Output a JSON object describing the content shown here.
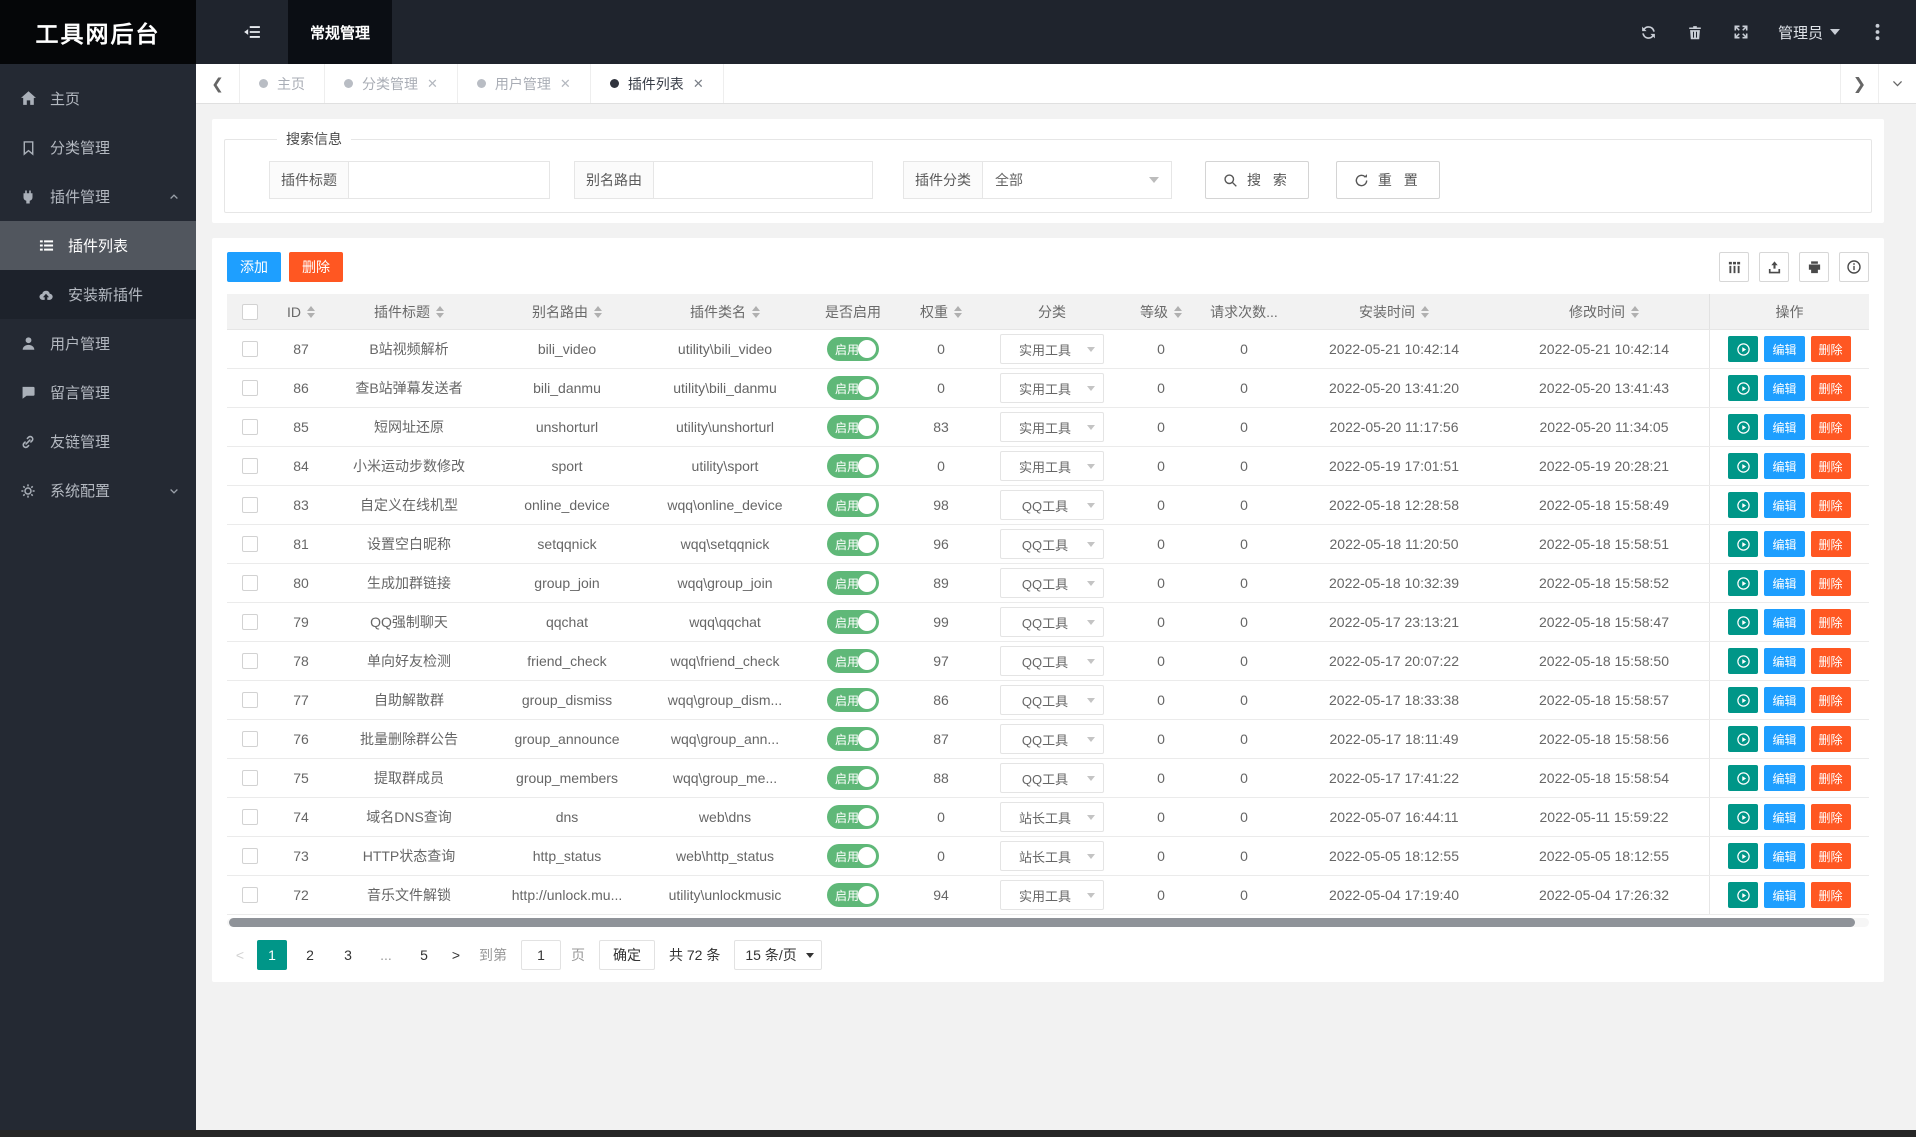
{
  "app": {
    "title": "工具网后台"
  },
  "topbar": {
    "nav_active": "常规管理",
    "user": "管理员",
    "icons": [
      "fold-icon",
      "refresh-icon",
      "trash-icon",
      "fullscreen-icon",
      "more-vertical-icon"
    ]
  },
  "sidebar": {
    "items": [
      {
        "label": "主页",
        "icon": "home-icon"
      },
      {
        "label": "分类管理",
        "icon": "bookmark-icon"
      },
      {
        "label": "插件管理",
        "icon": "plugin-icon",
        "expanded": true,
        "children": [
          {
            "label": "插件列表",
            "icon": "list-icon",
            "active": true
          },
          {
            "label": "安装新插件",
            "icon": "cloud-upload-icon"
          }
        ]
      },
      {
        "label": "用户管理",
        "icon": "user-icon"
      },
      {
        "label": "留言管理",
        "icon": "comment-icon"
      },
      {
        "label": "友链管理",
        "icon": "link-icon"
      },
      {
        "label": "系统配置",
        "icon": "gears-icon",
        "collapsed": true
      }
    ]
  },
  "tabs": [
    {
      "label": "主页",
      "closable": false,
      "active": false
    },
    {
      "label": "分类管理",
      "closable": true,
      "active": false
    },
    {
      "label": "用户管理",
      "closable": true,
      "active": false
    },
    {
      "label": "插件列表",
      "closable": true,
      "active": true
    }
  ],
  "search": {
    "legend": "搜索信息",
    "title_label": "插件标题",
    "title_value": "",
    "route_label": "别名路由",
    "route_value": "",
    "category_label": "插件分类",
    "category_value": "全部",
    "search_label": "搜 索",
    "reset_label": "重 置"
  },
  "toolbar": {
    "add_label": "添加",
    "delete_label": "删除",
    "icons": [
      "columns-filter-icon",
      "export-icon",
      "print-icon",
      "info-icon"
    ]
  },
  "table": {
    "switch_on_label": "启用",
    "actions": {
      "edit": "编辑",
      "delete": "删除"
    },
    "headers": [
      {
        "label": "ID",
        "sortable": true
      },
      {
        "label": "插件标题",
        "sortable": true
      },
      {
        "label": "别名路由",
        "sortable": true
      },
      {
        "label": "插件类名",
        "sortable": true
      },
      {
        "label": "是否启用",
        "sortable": false
      },
      {
        "label": "权重",
        "sortable": true
      },
      {
        "label": "分类",
        "sortable": false
      },
      {
        "label": "等级",
        "sortable": true
      },
      {
        "label": "请求次数...",
        "sortable": false
      },
      {
        "label": "安装时间",
        "sortable": true
      },
      {
        "label": "修改时间",
        "sortable": true
      },
      {
        "label": "操作",
        "sortable": false
      }
    ],
    "rows": [
      {
        "id": "87",
        "title": "B站视频解析",
        "route": "bili_video",
        "clazz": "utility\\bili_video",
        "weight": "0",
        "category": "实用工具",
        "level": "0",
        "requests": "0",
        "installed": "2022-05-21 10:42:14",
        "modified": "2022-05-21 10:42:14"
      },
      {
        "id": "86",
        "title": "查B站弹幕发送者",
        "route": "bili_danmu",
        "clazz": "utility\\bili_danmu",
        "weight": "0",
        "category": "实用工具",
        "level": "0",
        "requests": "0",
        "installed": "2022-05-20 13:41:20",
        "modified": "2022-05-20 13:41:43"
      },
      {
        "id": "85",
        "title": "短网址还原",
        "route": "unshorturl",
        "clazz": "utility\\unshorturl",
        "weight": "83",
        "category": "实用工具",
        "level": "0",
        "requests": "0",
        "installed": "2022-05-20 11:17:56",
        "modified": "2022-05-20 11:34:05"
      },
      {
        "id": "84",
        "title": "小米运动步数修改",
        "route": "sport",
        "clazz": "utility\\sport",
        "weight": "0",
        "category": "实用工具",
        "level": "0",
        "requests": "0",
        "installed": "2022-05-19 17:01:51",
        "modified": "2022-05-19 20:28:21"
      },
      {
        "id": "83",
        "title": "自定义在线机型",
        "route": "online_device",
        "clazz": "wqq\\online_device",
        "weight": "98",
        "category": "QQ工具",
        "level": "0",
        "requests": "0",
        "installed": "2022-05-18 12:28:58",
        "modified": "2022-05-18 15:58:49"
      },
      {
        "id": "81",
        "title": "设置空白昵称",
        "route": "setqqnick",
        "clazz": "wqq\\setqqnick",
        "weight": "96",
        "category": "QQ工具",
        "level": "0",
        "requests": "0",
        "installed": "2022-05-18 11:20:50",
        "modified": "2022-05-18 15:58:51"
      },
      {
        "id": "80",
        "title": "生成加群链接",
        "route": "group_join",
        "clazz": "wqq\\group_join",
        "weight": "89",
        "category": "QQ工具",
        "level": "0",
        "requests": "0",
        "installed": "2022-05-18 10:32:39",
        "modified": "2022-05-18 15:58:52"
      },
      {
        "id": "79",
        "title": "QQ强制聊天",
        "route": "qqchat",
        "clazz": "wqq\\qqchat",
        "weight": "99",
        "category": "QQ工具",
        "level": "0",
        "requests": "0",
        "installed": "2022-05-17 23:13:21",
        "modified": "2022-05-18 15:58:47"
      },
      {
        "id": "78",
        "title": "单向好友检测",
        "route": "friend_check",
        "clazz": "wqq\\friend_check",
        "weight": "97",
        "category": "QQ工具",
        "level": "0",
        "requests": "0",
        "installed": "2022-05-17 20:07:22",
        "modified": "2022-05-18 15:58:50"
      },
      {
        "id": "77",
        "title": "自助解散群",
        "route": "group_dismiss",
        "clazz": "wqq\\group_dism...",
        "weight": "86",
        "category": "QQ工具",
        "level": "0",
        "requests": "0",
        "installed": "2022-05-17 18:33:38",
        "modified": "2022-05-18 15:58:57"
      },
      {
        "id": "76",
        "title": "批量删除群公告",
        "route": "group_announce",
        "clazz": "wqq\\group_ann...",
        "weight": "87",
        "category": "QQ工具",
        "level": "0",
        "requests": "0",
        "installed": "2022-05-17 18:11:49",
        "modified": "2022-05-18 15:58:56"
      },
      {
        "id": "75",
        "title": "提取群成员",
        "route": "group_members",
        "clazz": "wqq\\group_me...",
        "weight": "88",
        "category": "QQ工具",
        "level": "0",
        "requests": "0",
        "installed": "2022-05-17 17:41:22",
        "modified": "2022-05-18 15:58:54"
      },
      {
        "id": "74",
        "title": "域名DNS查询",
        "route": "dns",
        "clazz": "web\\dns",
        "weight": "0",
        "category": "站长工具",
        "level": "0",
        "requests": "0",
        "installed": "2022-05-07 16:44:11",
        "modified": "2022-05-11 15:59:22"
      },
      {
        "id": "73",
        "title": "HTTP状态查询",
        "route": "http_status",
        "clazz": "web\\http_status",
        "weight": "0",
        "category": "站长工具",
        "level": "0",
        "requests": "0",
        "installed": "2022-05-05 18:12:55",
        "modified": "2022-05-05 18:12:55"
      },
      {
        "id": "72",
        "title": "音乐文件解锁",
        "route": "http://unlock.mu...",
        "clazz": "utility\\unlockmusic",
        "weight": "94",
        "category": "实用工具",
        "level": "0",
        "requests": "0",
        "installed": "2022-05-04 17:19:40",
        "modified": "2022-05-04 17:26:32"
      }
    ]
  },
  "pagination": {
    "pages": [
      "1",
      "2",
      "3",
      "...",
      "5"
    ],
    "active": "1",
    "prev": "<",
    "next": ">",
    "goto_label": "到第",
    "input_value": "1",
    "page_label": "页",
    "confirm_label": "确定",
    "total_label": "共 72 条",
    "per_page": "15 条/页"
  },
  "colors": {
    "accent_blue": "#1E9FFF",
    "accent_orange": "#FF5722",
    "teal": "#009688",
    "switch_green": "#5FB878"
  }
}
